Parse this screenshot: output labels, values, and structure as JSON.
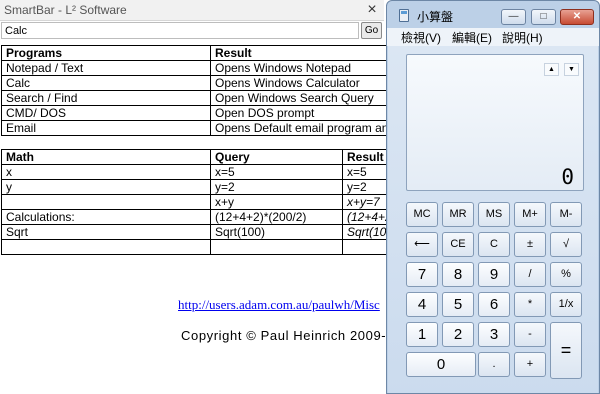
{
  "smartbar": {
    "title": "SmartBar - L² Software",
    "close_glyph": "×",
    "search_value": "Calc",
    "go_label": "Go",
    "programs_table": {
      "headers": [
        "Programs",
        "Result"
      ],
      "rows": [
        [
          "Notepad / Text",
          "Opens Windows Notepad"
        ],
        [
          "Calc",
          "Opens Windows Calculator"
        ],
        [
          "Search / Find",
          "Open Windows Search Query"
        ],
        [
          "CMD/ DOS",
          "Open DOS prompt"
        ],
        [
          "Email",
          "Opens Default email program an"
        ]
      ]
    },
    "math_table": {
      "headers": [
        "Math",
        "Query",
        "Result"
      ],
      "rows": [
        [
          "x",
          "x=5",
          "x=5"
        ],
        [
          "y",
          "y=2",
          "y=2"
        ],
        [
          "",
          "x+y",
          "x+y=7"
        ],
        [
          "Calculations:",
          "(12+4+2)*(200/2)",
          "(12+4+2"
        ],
        [
          "Sqrt",
          "Sqrt(100)",
          "Sqrt(10"
        ],
        [
          "",
          "",
          ""
        ]
      ]
    },
    "link_text": "http://users.adam.com.au/paulwh/Misc",
    "copyright": "Copyright © Paul Heinrich 2009-2"
  },
  "calculator": {
    "title": "小算盤",
    "min_glyph": "—",
    "max_glyph": "□",
    "close_glyph": "✕",
    "menu": [
      "檢視(V)",
      "編輯(E)",
      "說明(H)"
    ],
    "mem_up_glyph": "▲",
    "mem_down_glyph": "▼",
    "display_value": "0",
    "keys": {
      "mc": "MC",
      "mr": "MR",
      "ms": "MS",
      "mplus": "M+",
      "mminus": "M-",
      "back": "⟵",
      "ce": "CE",
      "c": "C",
      "plusminus": "±",
      "sqrt": "√",
      "n7": "7",
      "n8": "8",
      "n9": "9",
      "div": "/",
      "pct": "%",
      "n4": "4",
      "n5": "5",
      "n6": "6",
      "mul": "*",
      "recip": "1/x",
      "n1": "1",
      "n2": "2",
      "n3": "3",
      "sub": "-",
      "eq": "=",
      "n0": "0",
      "dot": ".",
      "add": "+"
    }
  }
}
